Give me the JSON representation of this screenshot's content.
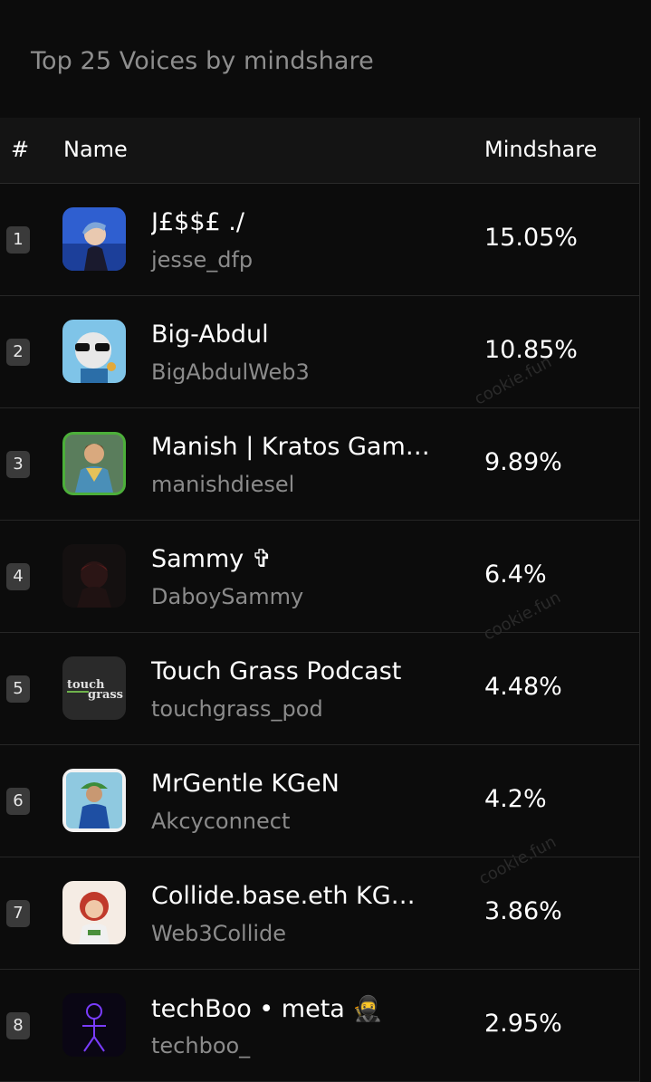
{
  "header": {
    "title": "Top 25 Voices by mindshare"
  },
  "table": {
    "columns": {
      "rank": "#",
      "name": "Name",
      "mindshare": "Mindshare"
    },
    "rows": [
      {
        "rank": "1",
        "name": "J£$$£ ./",
        "handle": "jesse_dfp",
        "mindshare": "15.05%",
        "avatar": "anime-character-avatar-icon"
      },
      {
        "rank": "2",
        "name": "Big-Abdul",
        "handle": "BigAbdulWeb3",
        "mindshare": "10.85%",
        "avatar": "sunglasses-character-avatar-icon"
      },
      {
        "rank": "3",
        "name": "Manish | Kratos Gam…",
        "handle": "manishdiesel",
        "mindshare": "9.89%",
        "avatar": "warrior-avatar-icon"
      },
      {
        "rank": "4",
        "name": "Sammy ✞",
        "handle": "DaboySammy",
        "mindshare": "6.4%",
        "avatar": "dark-portrait-avatar-icon"
      },
      {
        "rank": "5",
        "name": "Touch Grass Podcast",
        "handle": "touchgrass_pod",
        "mindshare": "4.48%",
        "avatar": "touch-grass-logo-icon"
      },
      {
        "rank": "6",
        "name": "MrGentle KGeN",
        "handle": "Akcyconnect",
        "mindshare": "4.2%",
        "avatar": "cricket-player-avatar-icon"
      },
      {
        "rank": "7",
        "name": "Collide.base.eth KG…",
        "handle": "Web3Collide",
        "mindshare": "3.86%",
        "avatar": "cartoon-girl-avatar-icon"
      },
      {
        "rank": "8",
        "name": "techBoo • meta 🥷",
        "handle": "techboo_",
        "mindshare": "2.95%",
        "avatar": "neon-figure-avatar-icon"
      }
    ]
  },
  "watermark": {
    "text": "cookie.fun"
  },
  "logo_text": {
    "touch": "touch",
    "grass": "grass"
  }
}
